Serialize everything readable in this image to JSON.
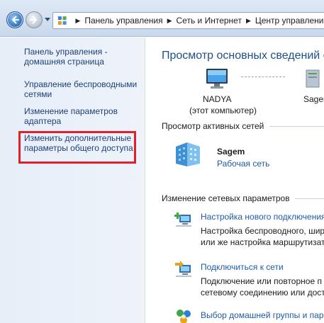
{
  "address_bar": {
    "crumbs": [
      "Панель управления",
      "Сеть и Интернет",
      "Центр управления"
    ]
  },
  "left_pane": {
    "links": [
      "Панель управления - домашняя страница",
      "Управление беспроводными сетями",
      "Изменение параметров адаптера",
      "Изменить дополнительные параметры общего доступа"
    ],
    "highlight_color": "#e0202a"
  },
  "main": {
    "title": "Просмотр основных сведений о",
    "network_map": {
      "computer_name": "NADYA",
      "computer_sub": "(этот компьютер)",
      "router_name": "Sagem"
    },
    "active_networks_heading": "Просмотр активных сетей",
    "active_network": {
      "name": "Sagem",
      "type": "Рабочая сеть"
    },
    "change_heading": "Изменение сетевых параметров",
    "items": [
      {
        "icon": "new-connection-icon",
        "link": "Настройка нового подключения",
        "desc1": "Настройка беспроводного, шир",
        "desc2": "или же настройка маршрутизат"
      },
      {
        "icon": "connect-network-icon",
        "link": "Подключиться к сети",
        "desc1": "Подключение или повторное п",
        "desc2": "сетевому соединению или дост"
      },
      {
        "icon": "homegroup-icon",
        "link": "Выбор домашней группы и пар"
      }
    ]
  },
  "colors": {
    "link": "#1e5aa8",
    "title": "#1e4e8c",
    "left_pane_link": "#1e3f78"
  }
}
